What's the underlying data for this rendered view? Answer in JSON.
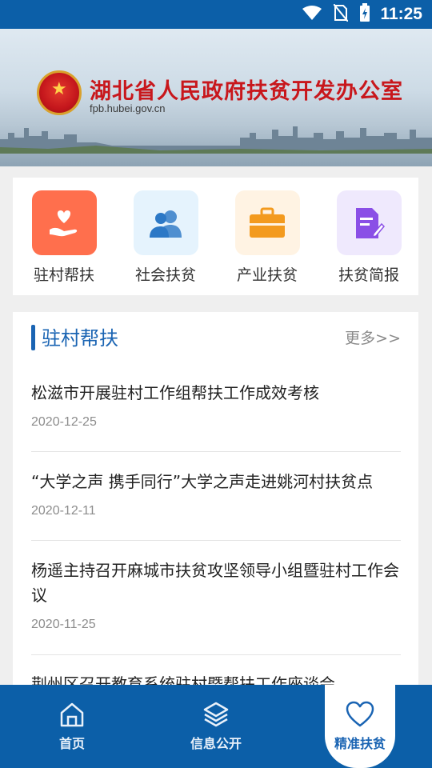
{
  "status_bar": {
    "time": "11:25"
  },
  "banner": {
    "title": "湖北省人民政府扶贫开发办公室",
    "domain": "fpb.hubei.gov.cn"
  },
  "categories": [
    {
      "label": "驻村帮扶",
      "icon": "hand-heart-icon",
      "color": "#ff6f4d"
    },
    {
      "label": "社会扶贫",
      "icon": "people-icon",
      "color": "#e5f3fd"
    },
    {
      "label": "产业扶贫",
      "icon": "briefcase-icon",
      "color": "#fff3e3"
    },
    {
      "label": "扶贫简报",
      "icon": "document-edit-icon",
      "color": "#efe9fd"
    }
  ],
  "news": {
    "heading": "驻村帮扶",
    "more": "更多>>",
    "items": [
      {
        "title": "松滋市开展驻村工作组帮扶工作成效考核",
        "date": "2020-12-25"
      },
      {
        "title": "“大学之声 携手同行”大学之声走进姚河村扶贫点",
        "date": "2020-12-11"
      },
      {
        "title": "杨遥主持召开麻城市扶贫攻坚领导小组暨驻村工作会议",
        "date": "2020-11-25"
      },
      {
        "title": "荆州区召开教育系统驻村暨帮扶工作座谈会",
        "date": ""
      }
    ]
  },
  "bottom_nav": [
    {
      "label": "首页",
      "icon": "home-icon"
    },
    {
      "label": "信息公开",
      "icon": "layers-icon"
    },
    {
      "label": "精准扶贫",
      "icon": "heart-icon",
      "active": true
    }
  ],
  "colors": {
    "brand_blue": "#0c5fa8",
    "accent_blue": "#1a64b3",
    "title_red": "#c8171c"
  }
}
